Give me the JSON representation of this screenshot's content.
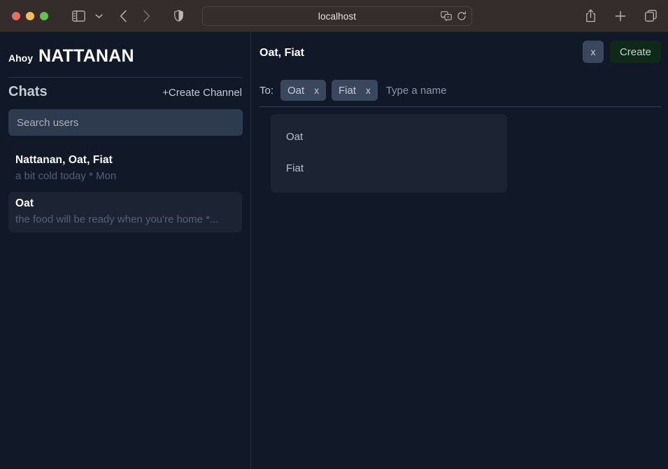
{
  "browser": {
    "url": "localhost",
    "icons": {
      "sidebar_toggle": "sidebar-toggle-icon",
      "sidebar_chevron": "chevron-down-icon",
      "back": "back-arrow-icon",
      "forward": "forward-arrow-icon",
      "shield": "shield-icon",
      "translate": "translate-icon",
      "reload": "reload-icon",
      "share": "share-icon",
      "new_tab": "plus-icon",
      "tab_overview": "tab-overview-icon"
    },
    "traffic_lights": {
      "close": "#ed6a5e",
      "minimize": "#f4bf4f",
      "maximize": "#61c454"
    }
  },
  "sidebar": {
    "greeting_prefix": "Ahoy",
    "user_name": "NATTANAN",
    "chats_title": "Chats",
    "create_channel_label": "+Create Channel",
    "search": {
      "placeholder": "Search users",
      "value": ""
    },
    "chats": [
      {
        "name": "Nattanan, Oat, Fiat",
        "preview": "a bit cold today * Mon",
        "selected": false
      },
      {
        "name": "Oat",
        "preview": "the food will be ready when you're home *...",
        "selected": true
      }
    ]
  },
  "main": {
    "channel_title": "Oat, Fiat",
    "close_label": "x",
    "create_label": "Create",
    "to_label": "To:",
    "recipients": [
      {
        "name": "Oat",
        "remove_label": "x"
      },
      {
        "name": "Fiat",
        "remove_label": "x"
      }
    ],
    "recipient_input": {
      "placeholder": "Type a name",
      "value": ""
    },
    "suggestions": [
      {
        "name": "Oat"
      },
      {
        "name": "Fiat"
      }
    ]
  },
  "colors": {
    "app_background": "#111827",
    "panel_raised": "#1c2332",
    "chip_background": "#3b475c",
    "input_background": "#2e3b4e",
    "create_button_background": "#0d2a19",
    "create_button_text": "#c6d2ca",
    "toolbar_background": "#342d2b"
  }
}
